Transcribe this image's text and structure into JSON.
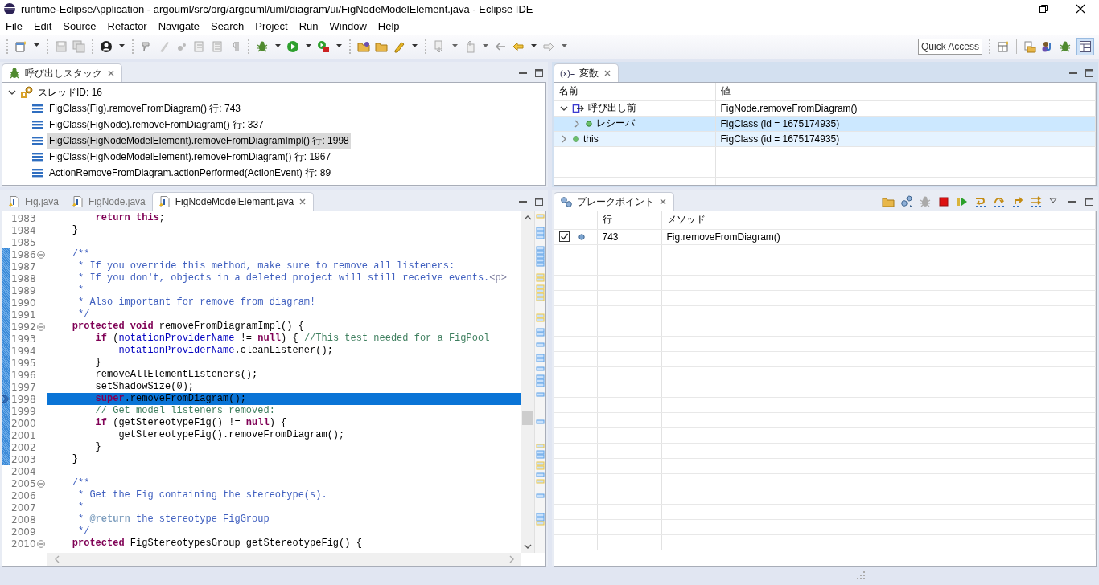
{
  "window": {
    "title": "runtime-EclipseApplication - argouml/src/org/argouml/uml/diagram/ui/FigNodeModelElement.java - Eclipse IDE"
  },
  "menu": [
    {
      "label": "File"
    },
    {
      "label": "Edit"
    },
    {
      "label": "Source"
    },
    {
      "label": "Refactor"
    },
    {
      "label": "Navigate"
    },
    {
      "label": "Search"
    },
    {
      "label": "Project"
    },
    {
      "label": "Run"
    },
    {
      "label": "Window"
    },
    {
      "label": "Help"
    }
  ],
  "toolbar": {
    "quick_access": "Quick Access"
  },
  "call_stack": {
    "tab": "呼び出しスタック",
    "thread": {
      "label": "スレッドID: 16",
      "expanded": true,
      "frames": [
        {
          "label": "FigClass(Fig).removeFromDiagram() 行: 743",
          "selected": false
        },
        {
          "label": "FigClass(FigNode).removeFromDiagram() 行: 337",
          "selected": false
        },
        {
          "label": "FigClass(FigNodeModelElement).removeFromDiagramImpl() 行: 1998",
          "selected": true
        },
        {
          "label": "FigClass(FigNodeModelElement).removeFromDiagram() 行: 1967",
          "selected": false
        },
        {
          "label": "ActionRemoveFromDiagram.actionPerformed(ActionEvent) 行: 89",
          "selected": false
        }
      ]
    }
  },
  "variables": {
    "tab_icon": "(x)=",
    "tab": "変数",
    "columns": [
      "名前",
      "値"
    ],
    "rows": [
      {
        "kind": "result",
        "name": "呼び出し前",
        "value": "FigNode.removeFromDiagram()",
        "expanded": true,
        "selected": false,
        "hovered": false,
        "children": [
          {
            "kind": "field",
            "name": "レシーバ",
            "value": "FigClass (id = 1675174935)",
            "expanded": false,
            "selected": true,
            "hovered": false
          }
        ]
      },
      {
        "kind": "field",
        "name": "this",
        "value": "FigClass (id = 1675174935)",
        "expanded": false,
        "selected": false,
        "hovered": true
      }
    ]
  },
  "editor": {
    "tabs": [
      {
        "label": "Fig.java",
        "selected": false
      },
      {
        "label": "FigNode.java",
        "selected": false
      },
      {
        "label": "FigNodeModelElement.java",
        "selected": true
      }
    ],
    "lines": [
      {
        "number": "1983",
        "fold": false,
        "in_range": false,
        "current": false,
        "segments": [
          {
            "kind": "keyword",
            "text": "        return"
          },
          {
            "kind": "keyword",
            "text": " this"
          },
          {
            "kind": "plain",
            "text": ";"
          }
        ]
      },
      {
        "number": "1984",
        "fold": false,
        "in_range": false,
        "current": false,
        "segments": [
          {
            "kind": "plain",
            "text": "    }"
          }
        ]
      },
      {
        "number": "1985",
        "fold": false,
        "in_range": false,
        "current": false
      },
      {
        "number": "1986",
        "fold": true,
        "in_range": true,
        "current": false,
        "segments": [
          {
            "kind": "doc",
            "text": "    /**"
          }
        ]
      },
      {
        "number": "1987",
        "fold": false,
        "in_range": true,
        "current": false,
        "segments": [
          {
            "kind": "doc",
            "text": "     * If you override this method, make sure to remove all listeners:"
          }
        ]
      },
      {
        "number": "1988",
        "fold": false,
        "in_range": true,
        "current": false,
        "segments": [
          {
            "kind": "doc",
            "text": "     * If you don't, objects in a deleted project will still receive events."
          },
          {
            "kind": "html",
            "text": "<p>"
          }
        ]
      },
      {
        "number": "1989",
        "fold": false,
        "in_range": true,
        "current": false,
        "segments": [
          {
            "kind": "doc",
            "text": "     *"
          }
        ]
      },
      {
        "number": "1990",
        "fold": false,
        "in_range": true,
        "current": false,
        "segments": [
          {
            "kind": "doc",
            "text": "     * Also important for remove from diagram!"
          }
        ]
      },
      {
        "number": "1991",
        "fold": false,
        "in_range": true,
        "current": false,
        "segments": [
          {
            "kind": "doc",
            "text": "     */"
          }
        ]
      },
      {
        "number": "1992",
        "fold": true,
        "in_range": true,
        "current": false,
        "segments": [
          {
            "kind": "keyword",
            "text": "    protected"
          },
          {
            "kind": "keyword",
            "text": " void"
          },
          {
            "kind": "plain",
            "text": " removeFromDiagramImpl() {"
          }
        ]
      },
      {
        "number": "1993",
        "fold": false,
        "in_range": true,
        "current": false,
        "segments": [
          {
            "kind": "keyword",
            "text": "        if"
          },
          {
            "kind": "plain",
            "text": " ("
          },
          {
            "kind": "field",
            "text": "notationProviderName"
          },
          {
            "kind": "plain",
            "text": " != "
          },
          {
            "kind": "keyword",
            "text": "null"
          },
          {
            "kind": "plain",
            "text": ") { "
          },
          {
            "kind": "comment",
            "text": "//This test needed for a FigPool"
          }
        ]
      },
      {
        "number": "1994",
        "fold": false,
        "in_range": true,
        "current": false,
        "segments": [
          {
            "kind": "field",
            "text": "            notationProviderName"
          },
          {
            "kind": "plain",
            "text": ".cleanListener();"
          }
        ]
      },
      {
        "number": "1995",
        "fold": false,
        "in_range": true,
        "current": false,
        "segments": [
          {
            "kind": "plain",
            "text": "        }"
          }
        ]
      },
      {
        "number": "1996",
        "fold": false,
        "in_range": true,
        "current": false,
        "segments": [
          {
            "kind": "plain",
            "text": "        removeAllElementListeners();"
          }
        ]
      },
      {
        "number": "1997",
        "fold": false,
        "in_range": true,
        "current": false,
        "segments": [
          {
            "kind": "plain",
            "text": "        setShadowSize(0);"
          }
        ]
      },
      {
        "number": "1998",
        "fold": false,
        "in_range": true,
        "current": true,
        "segments": [
          {
            "kind": "keyword",
            "text": "        super"
          },
          {
            "kind": "plain",
            "text": ".removeFromDiagram();"
          }
        ]
      },
      {
        "number": "1999",
        "fold": false,
        "in_range": true,
        "current": false,
        "segments": [
          {
            "kind": "comment",
            "text": "        // Get model listeners removed:"
          }
        ]
      },
      {
        "number": "2000",
        "fold": false,
        "in_range": true,
        "current": false,
        "segments": [
          {
            "kind": "keyword",
            "text": "        if"
          },
          {
            "kind": "plain",
            "text": " (getStereotypeFig() != "
          },
          {
            "kind": "keyword",
            "text": "null"
          },
          {
            "kind": "plain",
            "text": ") {"
          }
        ]
      },
      {
        "number": "2001",
        "fold": false,
        "in_range": true,
        "current": false,
        "segments": [
          {
            "kind": "plain",
            "text": "            getStereotypeFig().removeFromDiagram();"
          }
        ]
      },
      {
        "number": "2002",
        "fold": false,
        "in_range": true,
        "current": false,
        "segments": [
          {
            "kind": "plain",
            "text": "        }"
          }
        ]
      },
      {
        "number": "2003",
        "fold": false,
        "in_range": true,
        "current": false,
        "segments": [
          {
            "kind": "plain",
            "text": "    }"
          }
        ]
      },
      {
        "number": "2004",
        "fold": false,
        "in_range": false,
        "current": false
      },
      {
        "number": "2005",
        "fold": true,
        "in_range": false,
        "current": false,
        "segments": [
          {
            "kind": "doc",
            "text": "    /**"
          }
        ]
      },
      {
        "number": "2006",
        "fold": false,
        "in_range": false,
        "current": false,
        "segments": [
          {
            "kind": "doc",
            "text": "     * Get the Fig containing the stereotype(s)."
          }
        ]
      },
      {
        "number": "2007",
        "fold": false,
        "in_range": false,
        "current": false,
        "segments": [
          {
            "kind": "doc",
            "text": "     *"
          }
        ]
      },
      {
        "number": "2008",
        "fold": false,
        "in_range": false,
        "current": false,
        "segments": [
          {
            "kind": "doc",
            "text": "     * "
          },
          {
            "kind": "doctag",
            "text": "@return"
          },
          {
            "kind": "doc",
            "text": " the stereotype FigGroup"
          }
        ]
      },
      {
        "number": "2009",
        "fold": false,
        "in_range": false,
        "current": false,
        "segments": [
          {
            "kind": "doc",
            "text": "     */"
          }
        ]
      },
      {
        "number": "2010",
        "fold": true,
        "in_range": false,
        "current": false,
        "segments": [
          {
            "kind": "keyword",
            "text": "    protected"
          },
          {
            "kind": "plain",
            "text": " FigStereotypesGroup getStereotypeFig() {"
          }
        ]
      }
    ]
  },
  "breakpoints": {
    "tab": "ブレークポイント",
    "columns": [
      "行",
      "メソッド"
    ],
    "rows": [
      {
        "checked": true,
        "line": "743",
        "method": "Fig.removeFromDiagram()"
      }
    ]
  }
}
